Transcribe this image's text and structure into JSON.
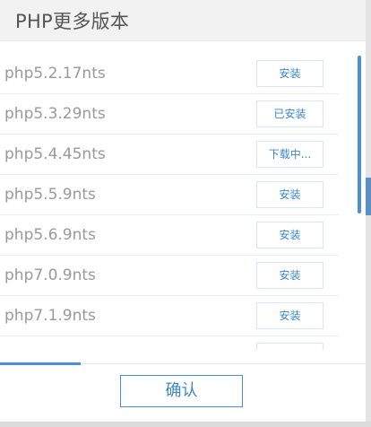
{
  "dialog": {
    "title": "PHP更多版本",
    "confirm_label": "确认"
  },
  "versions": [
    {
      "name": "php5.2.17nts",
      "action": "安装"
    },
    {
      "name": "php5.3.29nts",
      "action": "已安装"
    },
    {
      "name": "php5.4.45nts",
      "action": "下载中..."
    },
    {
      "name": "php5.5.9nts",
      "action": "安装"
    },
    {
      "name": "php5.6.9nts",
      "action": "安装"
    },
    {
      "name": "php7.0.9nts",
      "action": "安装"
    },
    {
      "name": "php7.1.9nts",
      "action": "安装"
    },
    {
      "name": "",
      "action": ""
    }
  ],
  "colors": {
    "accent": "#4a90d2",
    "title_bg": "#f2f2f2",
    "text_muted": "#999999"
  }
}
